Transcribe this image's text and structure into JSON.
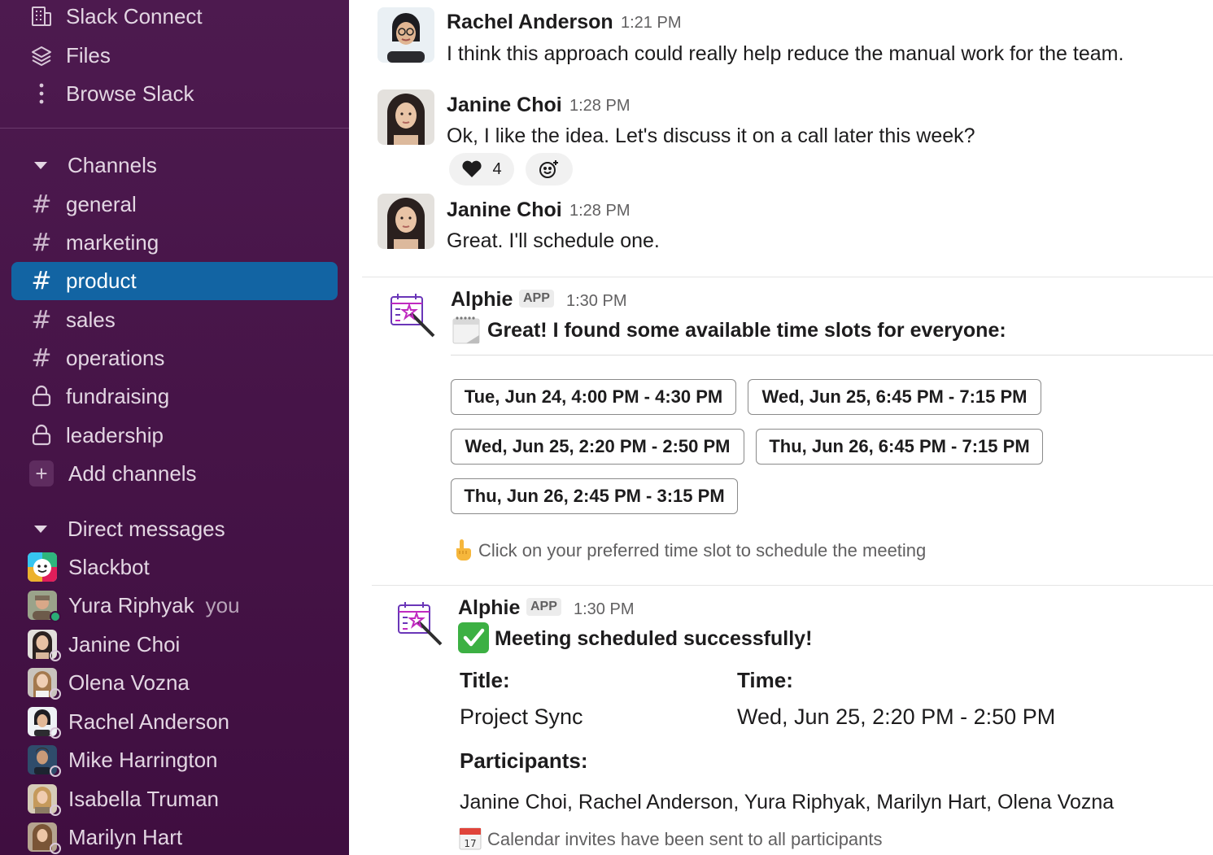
{
  "sidebar": {
    "top_items": [
      {
        "label": "Slack Connect",
        "icon": "building-icon"
      },
      {
        "label": "Files",
        "icon": "layers-icon"
      },
      {
        "label": "Browse Slack",
        "icon": "more-vertical-icon"
      }
    ],
    "channels_header": "Channels",
    "channels": [
      {
        "name": "general",
        "icon": "hash-icon"
      },
      {
        "name": "marketing",
        "icon": "hash-icon"
      },
      {
        "name": "product",
        "icon": "hash-icon",
        "active": true
      },
      {
        "name": "sales",
        "icon": "hash-icon"
      },
      {
        "name": "operations",
        "icon": "hash-icon"
      },
      {
        "name": "fundraising",
        "icon": "lock-icon"
      },
      {
        "name": "leadership",
        "icon": "lock-icon"
      }
    ],
    "add_channels_label": "Add channels",
    "dm_header": "Direct messages",
    "direct_messages": [
      {
        "name": "Slackbot",
        "suffix": ""
      },
      {
        "name": "Yura Riphyak",
        "suffix": "you"
      },
      {
        "name": "Janine Choi",
        "suffix": ""
      },
      {
        "name": "Olena Vozna",
        "suffix": ""
      },
      {
        "name": "Rachel Anderson",
        "suffix": ""
      },
      {
        "name": "Mike Harrington",
        "suffix": ""
      },
      {
        "name": "Isabella Truman",
        "suffix": ""
      },
      {
        "name": "Marilyn Hart",
        "suffix": ""
      }
    ],
    "colors": {
      "background": "#3f0e40",
      "active": "#1264a3",
      "online": "#2bac76"
    }
  },
  "messages": [
    {
      "sender": "Rachel Anderson",
      "time": "1:21 PM",
      "text": "I think this approach could really help reduce the manual work for the team."
    },
    {
      "sender": "Janine Choi",
      "time": "1:28 PM",
      "text": "Ok, I like the idea. Let's discuss it on a call later this week?",
      "reaction": {
        "emoji": "heart-icon",
        "count": "4"
      }
    },
    {
      "sender": "Janine Choi",
      "time": "1:28 PM",
      "text": "Great. I'll schedule one."
    }
  ],
  "alphie_slots": {
    "sender": "Alphie",
    "badge": "APP",
    "time": "1:30 PM",
    "headline": "Great! I found some available time slots for everyone:",
    "slots": [
      "Tue, Jun 24, 4:00 PM - 4:30 PM",
      "Wed, Jun 25, 6:45 PM - 7:15 PM",
      "Wed, Jun 25, 2:20 PM - 2:50 PM",
      "Thu, Jun 26, 6:45 PM - 7:15 PM",
      "Thu, Jun 26, 2:45 PM - 3:15 PM"
    ],
    "hint": "Click on your preferred time slot to schedule the meeting"
  },
  "alphie_confirm": {
    "sender": "Alphie",
    "badge": "APP",
    "time": "1:30 PM",
    "headline": "Meeting scheduled successfully!",
    "title_label": "Title:",
    "title_value": "Project Sync",
    "time_label": "Time:",
    "time_value": "Wed, Jun 25, 2:20 PM - 2:50 PM",
    "participants_label": "Participants:",
    "participants_value": "Janine Choi, Rachel Anderson, Yura Riphyak, Marilyn Hart, Olena Vozna",
    "footer": "Calendar invites have been sent to all participants",
    "calendar_day": "17"
  }
}
